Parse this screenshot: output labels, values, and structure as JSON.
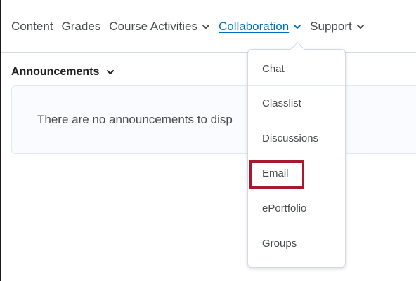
{
  "nav": {
    "items": [
      {
        "label": "Content",
        "has_menu": false,
        "active": false
      },
      {
        "label": "Grades",
        "has_menu": false,
        "active": false
      },
      {
        "label": "Course Activities",
        "has_menu": true,
        "active": false
      },
      {
        "label": "Collaboration",
        "has_menu": true,
        "active": true
      },
      {
        "label": "Support",
        "has_menu": true,
        "active": false
      }
    ],
    "chevron_icon": "chevron-down-icon",
    "active_color": "#006fbf"
  },
  "widget": {
    "title": "Announcements",
    "empty_text": "There are no announcements to disp"
  },
  "dropdown": {
    "items": [
      "Chat",
      "Classlist",
      "Discussions",
      "Email",
      "ePortfolio",
      "Groups"
    ],
    "highlighted": "Email",
    "highlight_color": "#a6192e"
  }
}
